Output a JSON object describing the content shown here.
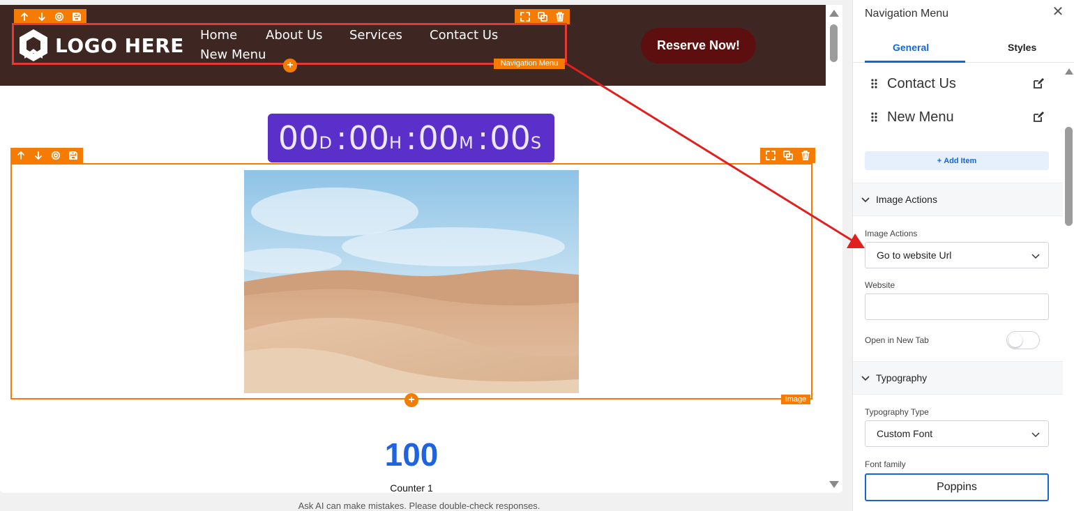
{
  "canvas": {
    "header": {
      "logo_text": "LOGO HERE",
      "nav_items": [
        "Home",
        "About Us",
        "Services",
        "Contact Us",
        "New Menu"
      ],
      "nav_element_label": "Navigation Menu",
      "reserve_button": "Reserve Now!"
    },
    "countdown": {
      "days": "00",
      "days_unit": "D",
      "hours": "00",
      "hours_unit": "H",
      "minutes": "00",
      "minutes_unit": "M",
      "seconds": "00",
      "seconds_unit": "S",
      "separator": ":"
    },
    "image_section": {
      "label": "Image",
      "plus": "+"
    },
    "counter": {
      "value": "100",
      "label": "Counter 1"
    },
    "disclaimer": "Ask AI can make mistakes. Please double-check responses."
  },
  "panel": {
    "title": "Navigation Menu",
    "close": "✕",
    "tabs": {
      "general": "General",
      "styles": "Styles"
    },
    "menu_items": [
      "Contact Us",
      "New Menu"
    ],
    "add_item": "Add Item",
    "image_actions_section": "Image Actions",
    "image_actions_label": "Image Actions",
    "image_actions_value": "Go to website Url",
    "website_label": "Website",
    "website_value": "",
    "open_new_tab_label": "Open in New Tab",
    "open_new_tab_on": false,
    "typography_section": "Typography",
    "typography_type_label": "Typography Type",
    "typography_type_value": "Custom Font",
    "font_family_label": "Font family",
    "font_family_value": "Poppins"
  },
  "colors": {
    "header_bg": "#3e2723",
    "editor_accent": "#f57c00",
    "selection_outline": "#e53935",
    "reserve_button": "#5d0f0f",
    "countdown_bg": "#5b2fc9",
    "counter_value": "#1e63e0",
    "panel_accent": "#1565d8"
  }
}
